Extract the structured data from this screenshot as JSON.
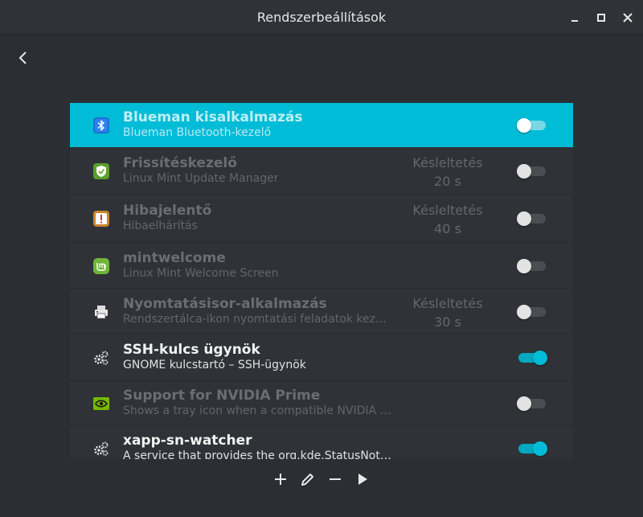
{
  "window": {
    "title": "Rendszerbeállítások"
  },
  "colors": {
    "accent": "#00bcd6",
    "background": "#2b2e33",
    "list_background": "#2f3237"
  },
  "startup_apps": [
    {
      "name": "Blueman kisalkalmazás",
      "description": "Blueman Bluetooth-kezelő",
      "delay_label": "",
      "delay_value": "",
      "enabled": false,
      "selected": true,
      "icon": "bluetooth-icon"
    },
    {
      "name": "Frissítéskezelő",
      "description": "Linux Mint Update Manager",
      "delay_label": "Késleltetés",
      "delay_value": "20 s",
      "enabled": false,
      "selected": false,
      "icon": "shield-icon"
    },
    {
      "name": "Hibajelentő",
      "description": "Hibaelhárítás",
      "delay_label": "Késleltetés",
      "delay_value": "40 s",
      "enabled": false,
      "selected": false,
      "icon": "warning-icon"
    },
    {
      "name": "mintwelcome",
      "description": "Linux Mint Welcome Screen",
      "delay_label": "",
      "delay_value": "",
      "enabled": false,
      "selected": false,
      "icon": "mint-logo-icon"
    },
    {
      "name": "Nyomtatásisor-alkalmazás",
      "description": "Rendszertálca-ikon nyomtatási feladatok kez…",
      "delay_label": "Késleltetés",
      "delay_value": "30 s",
      "enabled": false,
      "selected": false,
      "icon": "printer-icon"
    },
    {
      "name": "SSH-kulcs ügynök",
      "description": "GNOME kulcstartó – SSH-ügynök",
      "delay_label": "",
      "delay_value": "",
      "enabled": true,
      "selected": false,
      "icon": "gears-icon"
    },
    {
      "name": "Support for NVIDIA Prime",
      "description": "Shows a tray icon when a compatible NVIDIA …",
      "delay_label": "",
      "delay_value": "",
      "enabled": false,
      "selected": false,
      "icon": "nvidia-icon"
    },
    {
      "name": "xapp-sn-watcher",
      "description": "A service that provides the org.kde.StatusNot…",
      "delay_label": "",
      "delay_value": "",
      "enabled": true,
      "selected": false,
      "icon": "gears-icon"
    }
  ],
  "toolbar": {
    "add": "plus-icon",
    "edit": "pencil-icon",
    "remove": "minus-icon",
    "run": "play-icon"
  }
}
